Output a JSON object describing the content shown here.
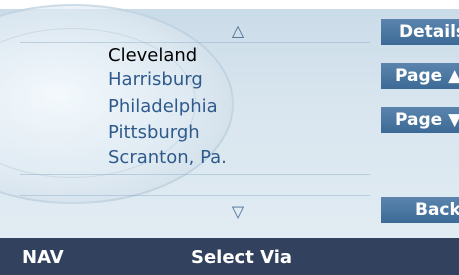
{
  "list": {
    "up_arrow": "△",
    "down_arrow": "▽",
    "items": [
      {
        "label": "Cleveland",
        "selected": true
      },
      {
        "label": "Harrisburg",
        "selected": false
      },
      {
        "label": "Philadelphia",
        "selected": false
      },
      {
        "label": "Pittsburgh",
        "selected": false
      },
      {
        "label": "Scranton, Pa.",
        "selected": false
      }
    ]
  },
  "buttons": {
    "details": "Details",
    "page_up": "Page ▲",
    "page_down": "Page ▼",
    "back": "Back"
  },
  "status": {
    "nav": "NAV",
    "mode": "Select Via"
  },
  "colors": {
    "button": "#4a78a3",
    "bottom_bar": "#31415e",
    "selected_text": "#000000",
    "list_text": "#2f5a8c"
  }
}
